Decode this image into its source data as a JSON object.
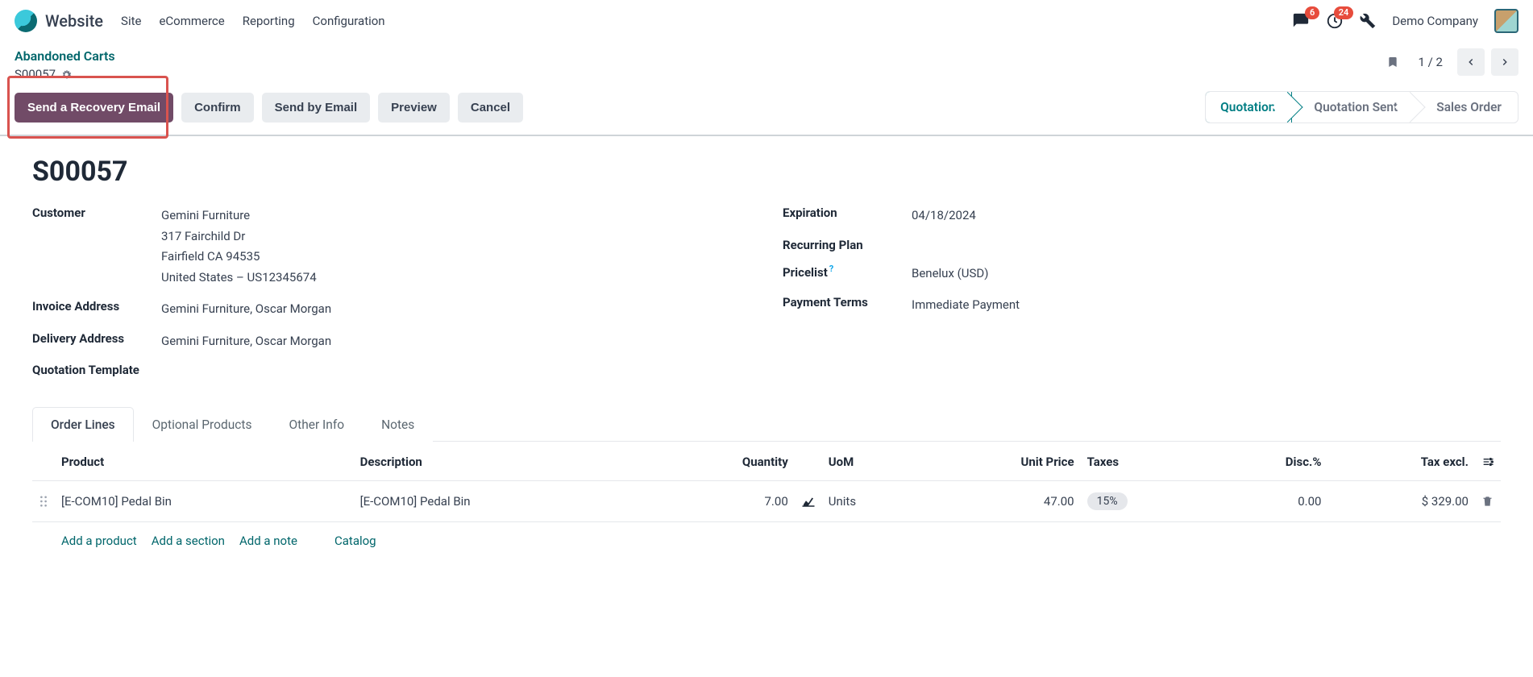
{
  "nav": {
    "app": "Website",
    "menu": [
      "Site",
      "eCommerce",
      "Reporting",
      "Configuration"
    ],
    "chat_badge": "6",
    "clock_badge": "24",
    "company": "Demo Company"
  },
  "breadcrumb": {
    "parent": "Abandoned Carts",
    "record": "S00057"
  },
  "pager": {
    "text": "1 / 2"
  },
  "actions": {
    "recovery": "Send a Recovery Email",
    "confirm": "Confirm",
    "send_email": "Send by Email",
    "preview": "Preview",
    "cancel": "Cancel"
  },
  "stages": {
    "quotation": "Quotation",
    "sent": "Quotation Sent",
    "order": "Sales Order"
  },
  "record": {
    "title": "S00057",
    "labels": {
      "customer": "Customer",
      "invoice_addr": "Invoice Address",
      "delivery_addr": "Delivery Address",
      "quote_tmpl": "Quotation Template",
      "expiration": "Expiration",
      "recurring": "Recurring Plan",
      "pricelist": "Pricelist",
      "payment_terms": "Payment Terms"
    },
    "customer": {
      "name": "Gemini Furniture",
      "street": "317 Fairchild Dr",
      "city": "Fairfield CA 94535",
      "country": "United States – US12345674"
    },
    "invoice_address": "Gemini Furniture, Oscar Morgan",
    "delivery_address": "Gemini Furniture, Oscar Morgan",
    "expiration": "04/18/2024",
    "pricelist": "Benelux (USD)",
    "payment_terms": "Immediate Payment"
  },
  "tabs": {
    "order_lines": "Order Lines",
    "optional": "Optional Products",
    "other": "Other Info",
    "notes": "Notes"
  },
  "table": {
    "headers": {
      "product": "Product",
      "description": "Description",
      "quantity": "Quantity",
      "uom": "UoM",
      "unit_price": "Unit Price",
      "taxes": "Taxes",
      "disc": "Disc.%",
      "tax_excl": "Tax excl."
    },
    "row": {
      "product": "[E-COM10] Pedal Bin",
      "description": "[E-COM10] Pedal Bin",
      "qty": "7.00",
      "uom": "Units",
      "unit_price": "47.00",
      "tax": "15%",
      "disc": "0.00",
      "tax_excl": "$ 329.00"
    },
    "actions": {
      "add_product": "Add a product",
      "add_section": "Add a section",
      "add_note": "Add a note",
      "catalog": "Catalog"
    }
  }
}
